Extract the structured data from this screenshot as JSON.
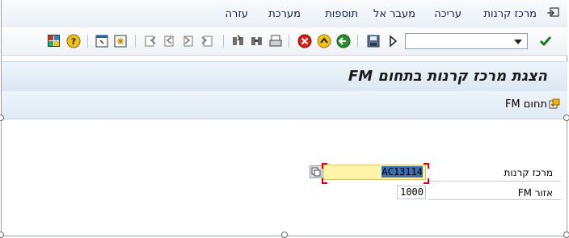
{
  "menu": {
    "items": [
      "מרכז קרנות",
      "עריכה",
      "מעבר אל",
      "תוספות",
      "מערכת",
      "עזרה"
    ]
  },
  "toolbar": {
    "command_field_value": "",
    "icons": [
      "enter-icon",
      "save-icon",
      "back-icon",
      "exit-icon",
      "cancel-icon",
      "print-icon",
      "find-icon",
      "find-next-icon",
      "first-page-icon",
      "prev-page-icon",
      "next-page-icon",
      "last-page-icon",
      "new-session-icon",
      "shortcut-icon",
      "help-icon",
      "customize-layout-icon"
    ]
  },
  "title": "הצגת מרכז קרנות בתחום FM",
  "app_toolbar": {
    "fm_area_button": "תחום FM"
  },
  "form": {
    "fund_center_label": "מרכז קרנות",
    "fund_center_value": "AC13114",
    "fm_area_label": "אזור FM",
    "fm_area_value": "1000"
  }
}
